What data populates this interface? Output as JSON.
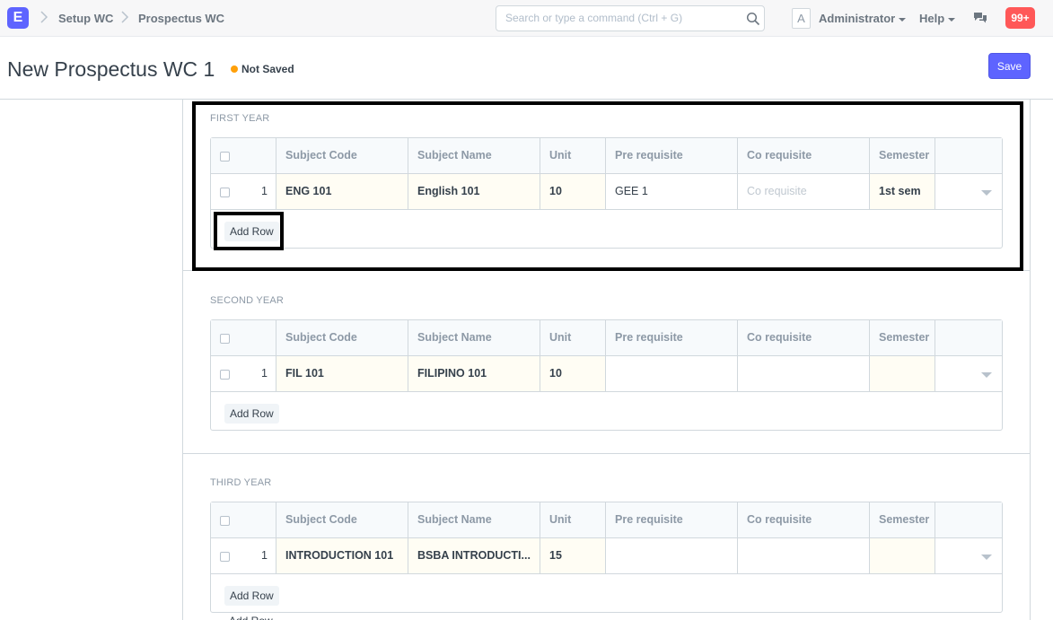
{
  "navbar": {
    "logo": "E",
    "breadcrumbs": [
      "Setup WC",
      "Prospectus WC"
    ],
    "search_placeholder": "Search or type a command (Ctrl + G)",
    "avatar_letter": "A",
    "user": "Administrator",
    "help": "Help",
    "notifications": "99+"
  },
  "page": {
    "title": "New Prospectus WC 1",
    "status": "Not Saved",
    "save_label": "Save"
  },
  "grid_columns": [
    "Subject Code",
    "Subject Name",
    "Unit",
    "Pre requisite",
    "Co requisite",
    "Semester"
  ],
  "add_row_label": "Add Row",
  "sections": [
    {
      "label": "FIRST YEAR",
      "row": {
        "idx": "1",
        "subject_code": "ENG 101",
        "subject_name": "English 101",
        "unit": "10",
        "pre_requisite": "GEE 1",
        "co_requisite": "",
        "co_requisite_placeholder": "Co requisite",
        "semester": "1st sem"
      }
    },
    {
      "label": "SECOND YEAR",
      "row": {
        "idx": "1",
        "subject_code": "FIL 101",
        "subject_name": "FILIPINO 101",
        "unit": "10",
        "pre_requisite": "",
        "co_requisite": "",
        "semester": ""
      }
    },
    {
      "label": "THIRD YEAR",
      "row": {
        "idx": "1",
        "subject_code": "INTRODUCTION 101",
        "subject_name": "BSBA INTRODUCTI...",
        "unit": "15",
        "pre_requisite": "",
        "co_requisite": "",
        "semester": ""
      }
    }
  ],
  "colors": {
    "primary": "#5e64ff",
    "status_dot": "#ffa00a",
    "badge": "#ff5858"
  }
}
